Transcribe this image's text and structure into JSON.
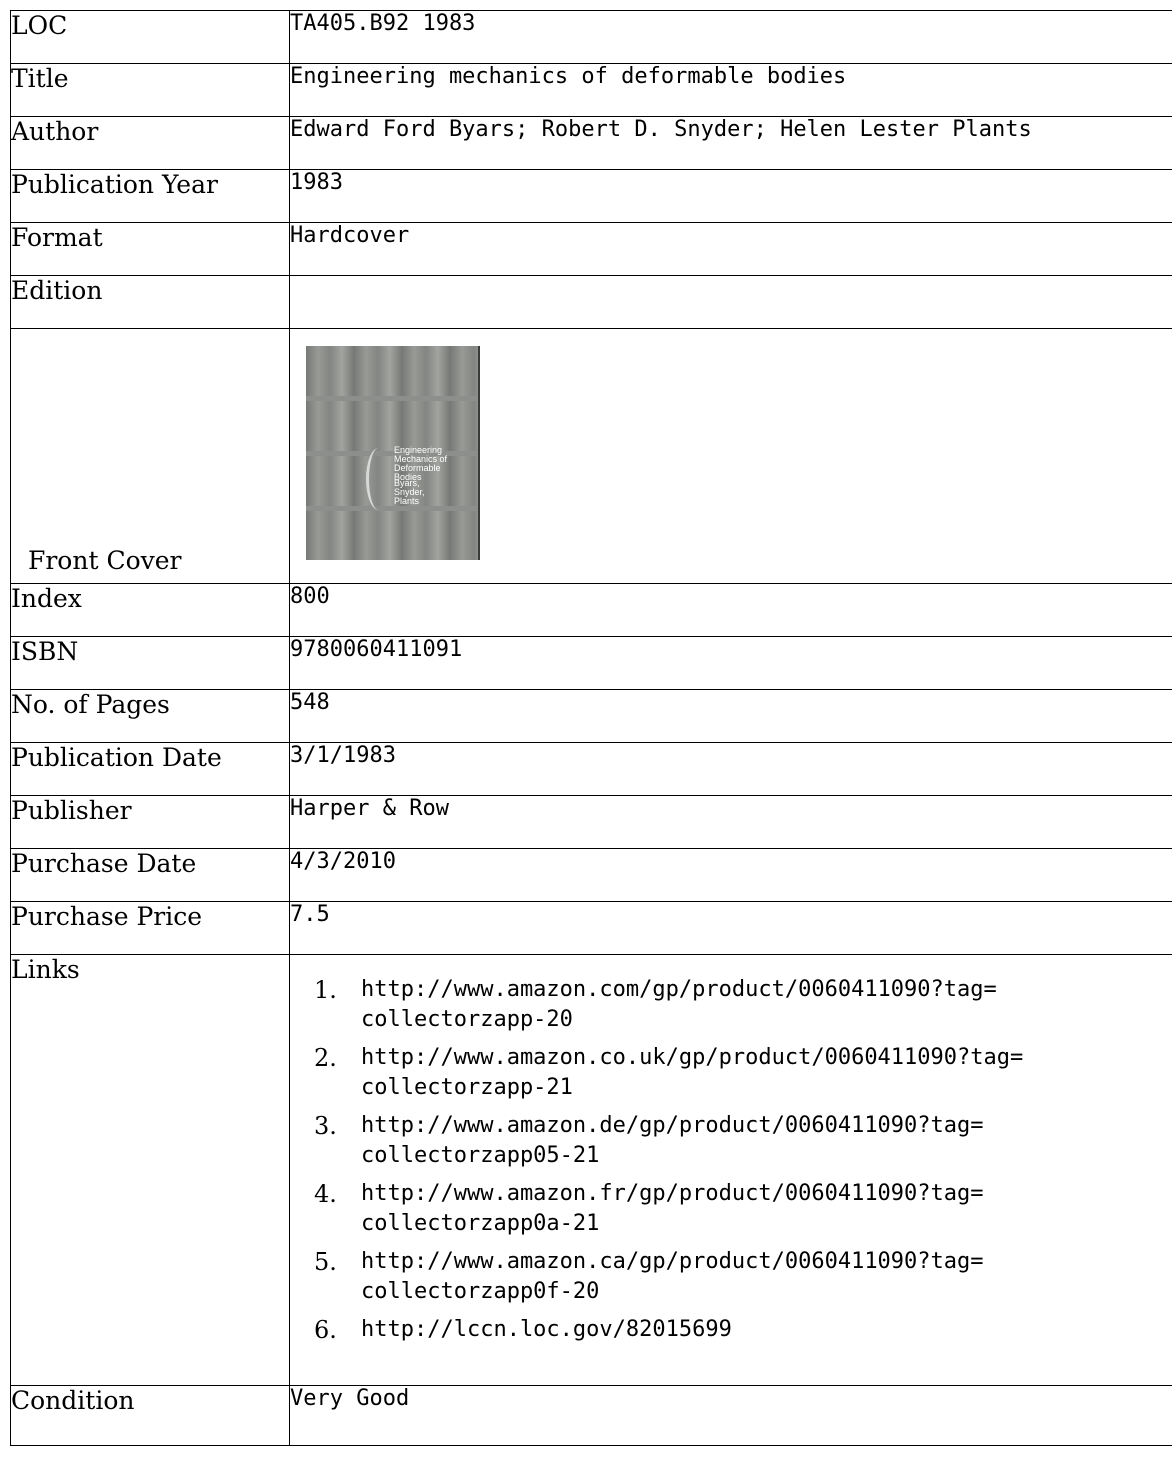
{
  "fields": {
    "loc": {
      "label": "LOC",
      "value": "TA405.B92 1983"
    },
    "title": {
      "label": "Title",
      "value": "Engineering mechanics of deformable bodies"
    },
    "author": {
      "label": "Author",
      "value": "Edward Ford Byars; Robert D. Snyder; Helen Lester Plants"
    },
    "pub_year": {
      "label": "Publication Year",
      "value": "1983"
    },
    "format": {
      "label": "Format",
      "value": "Hardcover"
    },
    "edition": {
      "label": "Edition",
      "value": ""
    },
    "front_cover": {
      "label": "Front Cover",
      "cover_title": "Engineering\nMechanics of\nDeformable\nBodies",
      "cover_authors": "Byars,\nSnyder,\nPlants"
    },
    "index": {
      "label": "Index",
      "value": "800"
    },
    "isbn": {
      "label": "ISBN",
      "value": "9780060411091"
    },
    "pages": {
      "label": "No. of Pages",
      "value": "548"
    },
    "pub_date": {
      "label": "Publication Date",
      "value": "3/1/1983"
    },
    "publisher": {
      "label": "Publisher",
      "value": "Harper & Row"
    },
    "purchase_date": {
      "label": "Purchase Date",
      "value": "4/3/2010"
    },
    "purchase_price": {
      "label": "Purchase Price",
      "value": "7.5"
    },
    "links": {
      "label": "Links",
      "items": [
        {
          "num": "1.",
          "url": "http://www.amazon.com/gp/product/0060411090?tag=\ncollectorzapp-20"
        },
        {
          "num": "2.",
          "url": "http://www.amazon.co.uk/gp/product/0060411090?tag=\ncollectorzapp-21"
        },
        {
          "num": "3.",
          "url": "http://www.amazon.de/gp/product/0060411090?tag=\ncollectorzapp05-21"
        },
        {
          "num": "4.",
          "url": "http://www.amazon.fr/gp/product/0060411090?tag=\ncollectorzapp0a-21"
        },
        {
          "num": "5.",
          "url": "http://www.amazon.ca/gp/product/0060411090?tag=\ncollectorzapp0f-20"
        },
        {
          "num": "6.",
          "url": "http://lccn.loc.gov/82015699"
        }
      ]
    },
    "condition": {
      "label": "Condition",
      "value": "Very Good"
    }
  }
}
